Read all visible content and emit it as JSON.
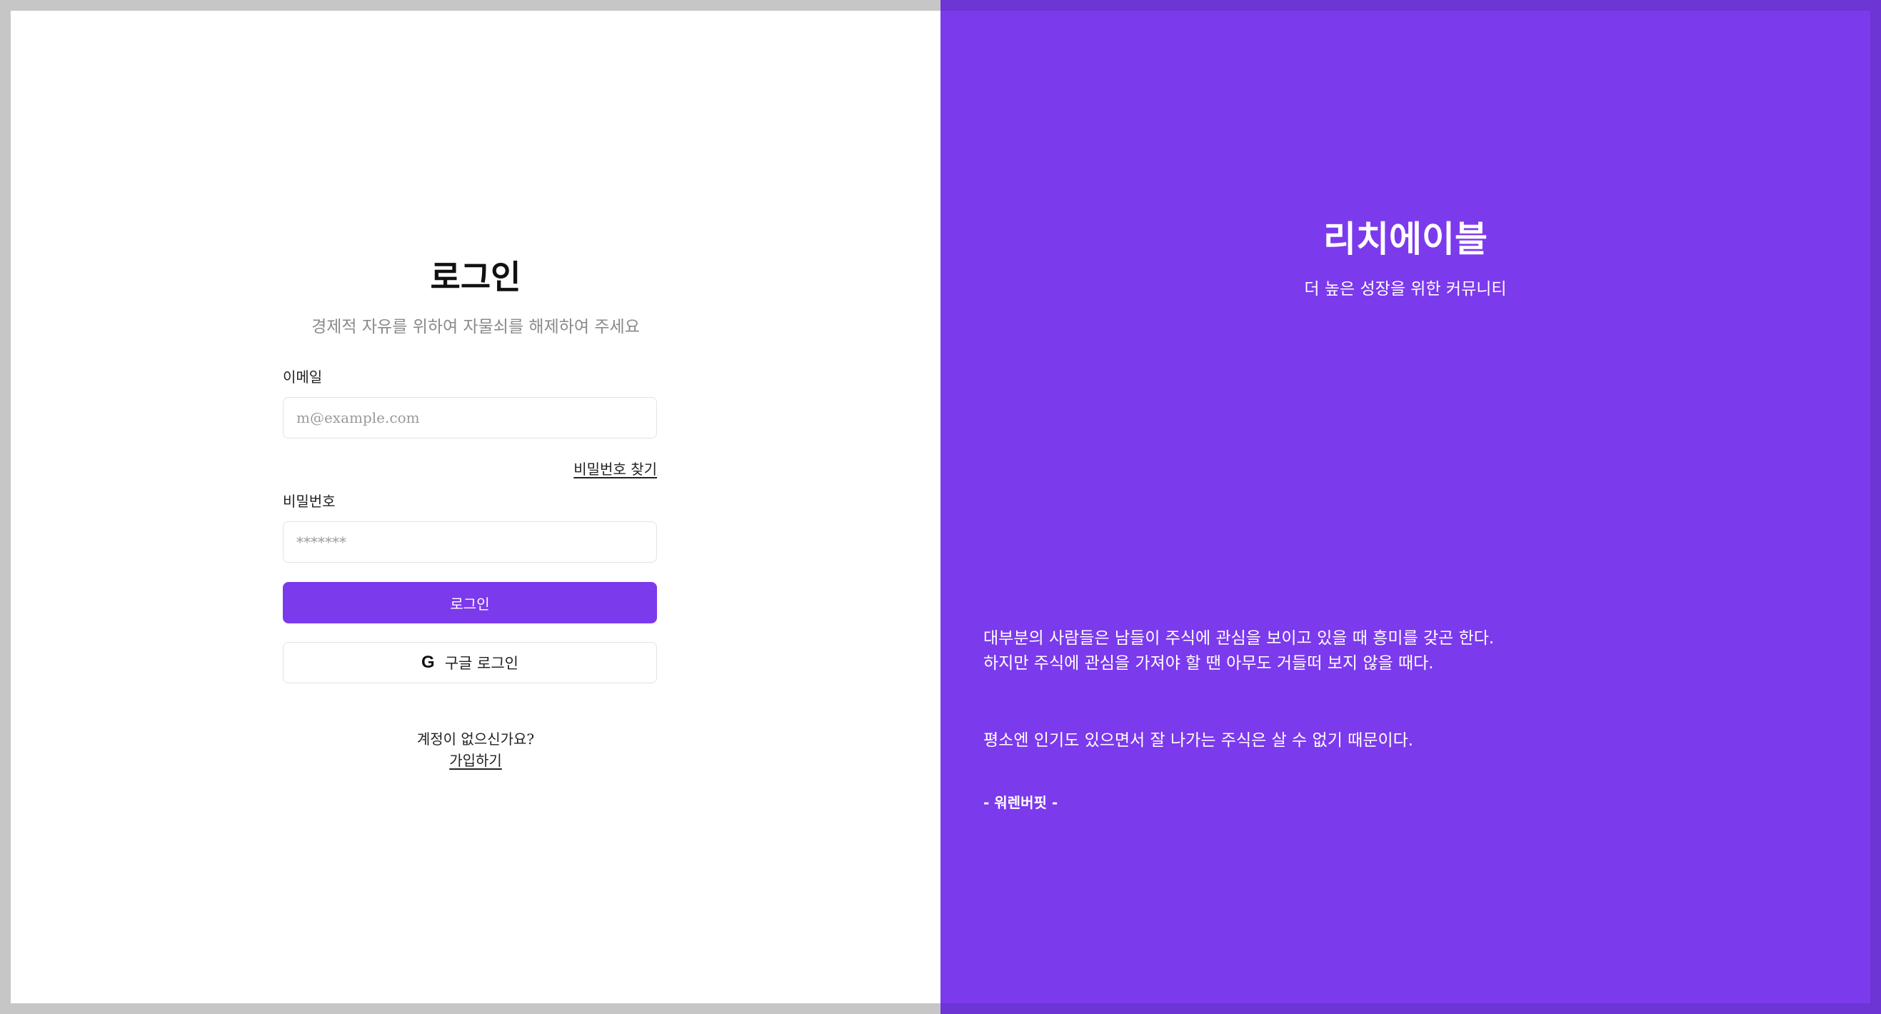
{
  "login": {
    "title": "로그인",
    "subtitle": "경제적 자유를 위하여 자물쇠를 해제하여 주세요",
    "email_label": "이메일",
    "email_placeholder": "m@example.com",
    "forgot_password": "비밀번호 찾기",
    "password_label": "비밀번호",
    "password_placeholder": "*******",
    "submit_label": "로그인",
    "google_label": "구글 로그인",
    "google_icon": "google-icon",
    "no_account": "계정이 없으신가요?",
    "signup": "가입하기"
  },
  "brand": {
    "title": "리치에이블",
    "subtitle": "더 높은 성장을 위한 커뮤니티",
    "quote_line1": "대부분의 사람들은 남들이 주식에 관심을 보이고 있을 때 흥미를 갖곤 한다.",
    "quote_line2": "하지만 주식에 관심을 가져야 할 땐 아무도 거들떠 보지 않을 때다.",
    "quote_line3": "평소엔 인기도 있으면서 잘 나가는 주식은 살 수 없기 때문이다.",
    "quote_author": "- 워렌버핏 -"
  },
  "colors": {
    "accent": "#7c3aed",
    "background": "#ffffff"
  }
}
